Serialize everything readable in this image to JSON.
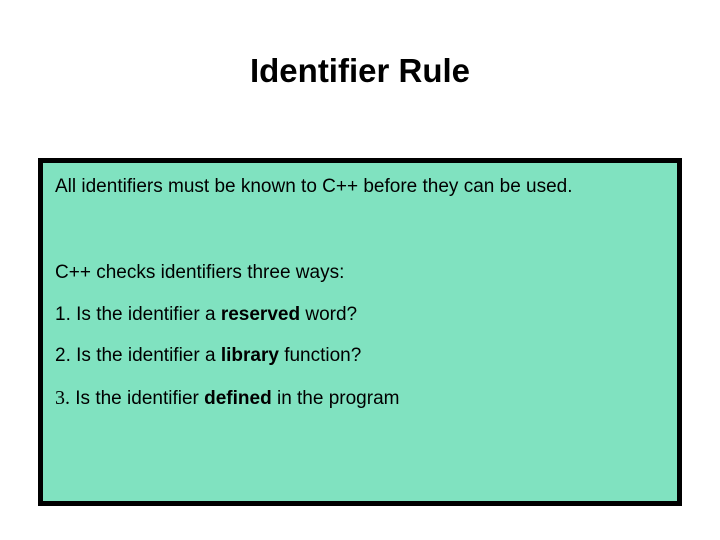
{
  "title": "Identifier Rule",
  "intro": "All identifiers must be known to C++ before they can be used.",
  "subheading": "C++ checks identifiers three ways:",
  "items": [
    {
      "num": "1.",
      "prefix": "  Is the identifier a ",
      "bold": "reserved",
      "suffix": " word?"
    },
    {
      "num": "2.",
      "prefix": "  Is the identifier a ",
      "bold": "library",
      "suffix": " function?"
    },
    {
      "num": "3.",
      "prefix": "  Is the identifier ",
      "bold": "defined",
      "suffix": " in the program"
    }
  ]
}
